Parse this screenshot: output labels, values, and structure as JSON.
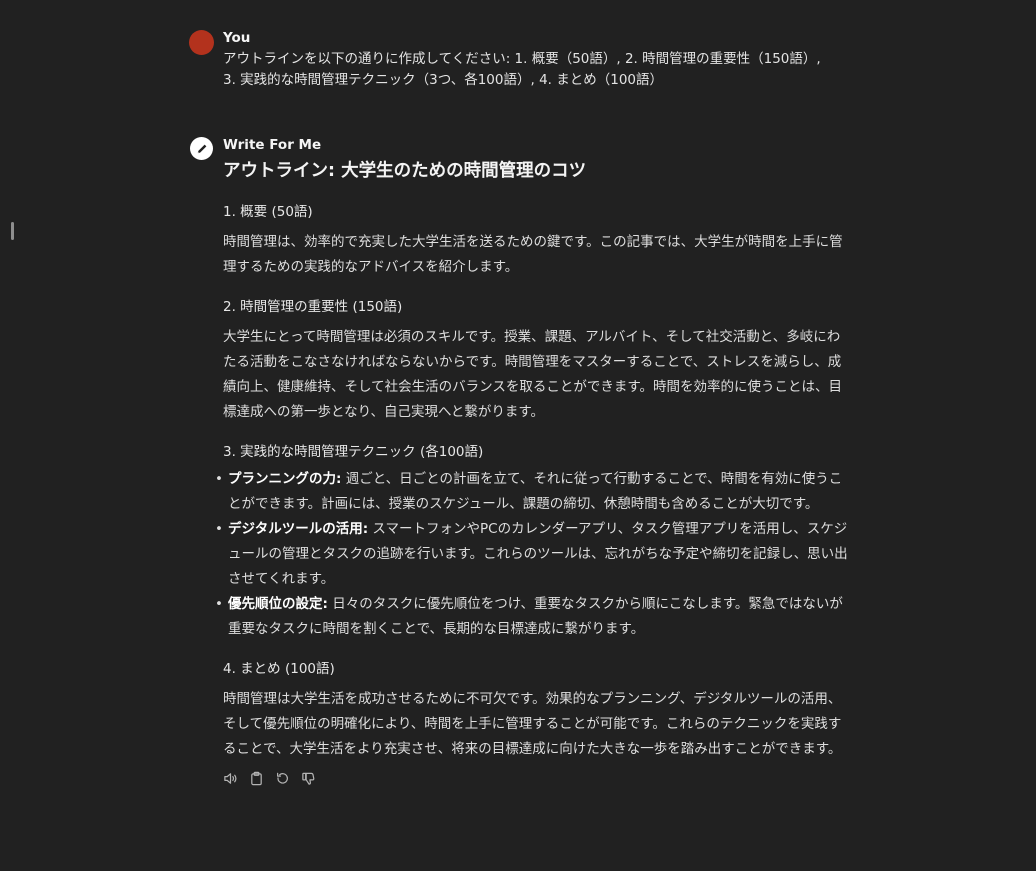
{
  "user_message": {
    "author": "You",
    "text": "アウトラインを以下の通りに作成してください: 1. 概要（50語）, 2. 時間管理の重要性（150語）,\n3. 実践的な時間管理テクニック（3つ、各100語）, 4. まとめ（100語）"
  },
  "bot_message": {
    "author": "Write For Me",
    "title": "アウトライン: 大学生のための時間管理のコツ",
    "sections": [
      {
        "heading": "1. 概要 (50語)",
        "paragraph": "時間管理は、効率的で充実した大学生活を送るための鍵です。この記事では、大学生が時間を上手に管理するための実践的なアドバイスを紹介します。"
      },
      {
        "heading": "2. 時間管理の重要性 (150語)",
        "paragraph": "大学生にとって時間管理は必須のスキルです。授業、課題、アルバイト、そして社交活動と、多岐にわたる活動をこなさなければならないからです。時間管理をマスターすることで、ストレスを減らし、成績向上、健康維持、そして社会生活のバランスを取ることができます。時間を効率的に使うことは、目標達成への第一歩となり、自己実現へと繋がります。"
      },
      {
        "heading": "3. 実践的な時間管理テクニック (各100語)",
        "bullets": [
          {
            "label": "プランニングの力:",
            "text": " 週ごと、日ごとの計画を立て、それに従って行動することで、時間を有効に使うことができます。計画には、授業のスケジュール、課題の締切、休憩時間も含めることが大切です。"
          },
          {
            "label": "デジタルツールの活用:",
            "text": " スマートフォンやPCのカレンダーアプリ、タスク管理アプリを活用し、スケジュールの管理とタスクの追跡を行います。これらのツールは、忘れがちな予定や締切を記録し、思い出させてくれます。"
          },
          {
            "label": "優先順位の設定:",
            "text": " 日々のタスクに優先順位をつけ、重要なタスクから順にこなします。緊急ではないが重要なタスクに時間を割くことで、長期的な目標達成に繋がります。"
          }
        ]
      },
      {
        "heading": "4. まとめ (100語)",
        "paragraph": "時間管理は大学生活を成功させるために不可欠です。効果的なプランニング、デジタルツールの活用、そして優先順位の明確化により、時間を上手に管理することが可能です。これらのテクニックを実践することで、大学生活をより充実させ、将来の目標達成に向けた大きな一歩を踏み出すことができます。"
      }
    ],
    "actions": [
      {
        "name": "read-aloud-icon"
      },
      {
        "name": "copy-icon"
      },
      {
        "name": "regenerate-icon"
      },
      {
        "name": "thumbs-down-icon"
      }
    ]
  },
  "colors": {
    "background": "#212121",
    "user_avatar": "#b3321d",
    "text": "#ececec"
  }
}
